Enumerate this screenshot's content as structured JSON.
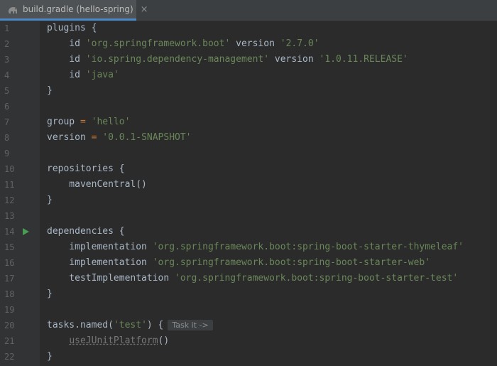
{
  "tab": {
    "label": "build.gradle (hello-spring)",
    "close": "×",
    "icon": "gradle-elephant-icon"
  },
  "lines": [
    {
      "n": "1",
      "tokens": [
        {
          "t": "plugins",
          "c": "fn"
        },
        {
          "t": " {",
          "c": "plain"
        }
      ]
    },
    {
      "n": "2",
      "tokens": [
        {
          "t": "    id ",
          "c": "plain"
        },
        {
          "t": "'org.springframework.boot'",
          "c": "str"
        },
        {
          "t": " version ",
          "c": "plain"
        },
        {
          "t": "'2.7.0'",
          "c": "str"
        }
      ]
    },
    {
      "n": "3",
      "tokens": [
        {
          "t": "    id ",
          "c": "plain"
        },
        {
          "t": "'io.spring.dependency-management'",
          "c": "str"
        },
        {
          "t": " version ",
          "c": "plain"
        },
        {
          "t": "'1.0.11.RELEASE'",
          "c": "str"
        }
      ]
    },
    {
      "n": "4",
      "tokens": [
        {
          "t": "    id ",
          "c": "plain"
        },
        {
          "t": "'java'",
          "c": "str"
        }
      ]
    },
    {
      "n": "5",
      "tokens": [
        {
          "t": "}",
          "c": "plain"
        }
      ]
    },
    {
      "n": "6",
      "tokens": []
    },
    {
      "n": "7",
      "tokens": [
        {
          "t": "group ",
          "c": "plain"
        },
        {
          "t": "=",
          "c": "kw"
        },
        {
          "t": " ",
          "c": "plain"
        },
        {
          "t": "'hello'",
          "c": "str"
        }
      ]
    },
    {
      "n": "8",
      "tokens": [
        {
          "t": "version ",
          "c": "plain"
        },
        {
          "t": "=",
          "c": "kw"
        },
        {
          "t": " ",
          "c": "plain"
        },
        {
          "t": "'0.0.1-SNAPSHOT'",
          "c": "str"
        }
      ]
    },
    {
      "n": "9",
      "tokens": []
    },
    {
      "n": "10",
      "tokens": [
        {
          "t": "repositories",
          "c": "fn"
        },
        {
          "t": " {",
          "c": "plain"
        }
      ]
    },
    {
      "n": "11",
      "tokens": [
        {
          "t": "    mavenCentral()",
          "c": "plain"
        }
      ]
    },
    {
      "n": "12",
      "tokens": [
        {
          "t": "}",
          "c": "plain"
        }
      ]
    },
    {
      "n": "13",
      "tokens": []
    },
    {
      "n": "14",
      "run": true,
      "tokens": [
        {
          "t": "dependencies",
          "c": "fn"
        },
        {
          "t": " {",
          "c": "plain"
        }
      ]
    },
    {
      "n": "15",
      "tokens": [
        {
          "t": "    implementation ",
          "c": "plain"
        },
        {
          "t": "'org.springframework.boot:spring-boot-starter-thymeleaf'",
          "c": "str"
        }
      ]
    },
    {
      "n": "16",
      "tokens": [
        {
          "t": "    implementation ",
          "c": "plain"
        },
        {
          "t": "'org.springframework.boot:spring-boot-starter-web'",
          "c": "str"
        }
      ]
    },
    {
      "n": "17",
      "tokens": [
        {
          "t": "    testImplementation ",
          "c": "plain"
        },
        {
          "t": "'org.springframework.boot:spring-boot-starter-test'",
          "c": "str"
        }
      ]
    },
    {
      "n": "18",
      "tokens": [
        {
          "t": "}",
          "c": "plain"
        }
      ]
    },
    {
      "n": "19",
      "tokens": []
    },
    {
      "n": "20",
      "tokens": [
        {
          "t": "tasks.",
          "c": "plain"
        },
        {
          "t": "named",
          "c": "fn"
        },
        {
          "t": "(",
          "c": "plain"
        },
        {
          "t": "'test'",
          "c": "str"
        },
        {
          "t": ") {",
          "c": "plain"
        }
      ],
      "hint": "Task it ->"
    },
    {
      "n": "21",
      "tokens": [
        {
          "t": "    ",
          "c": "plain"
        },
        {
          "t": "useJUnitPlatform",
          "c": "muted"
        },
        {
          "t": "()",
          "c": "plain"
        }
      ]
    },
    {
      "n": "22",
      "tokens": [
        {
          "t": "}",
          "c": "plain"
        }
      ]
    }
  ],
  "colors": {
    "background": "#2b2b2b",
    "gutter": "#313335",
    "string": "#6a8759",
    "operator": "#cc7832",
    "text": "#a9b7c6",
    "run": "#499c54"
  }
}
